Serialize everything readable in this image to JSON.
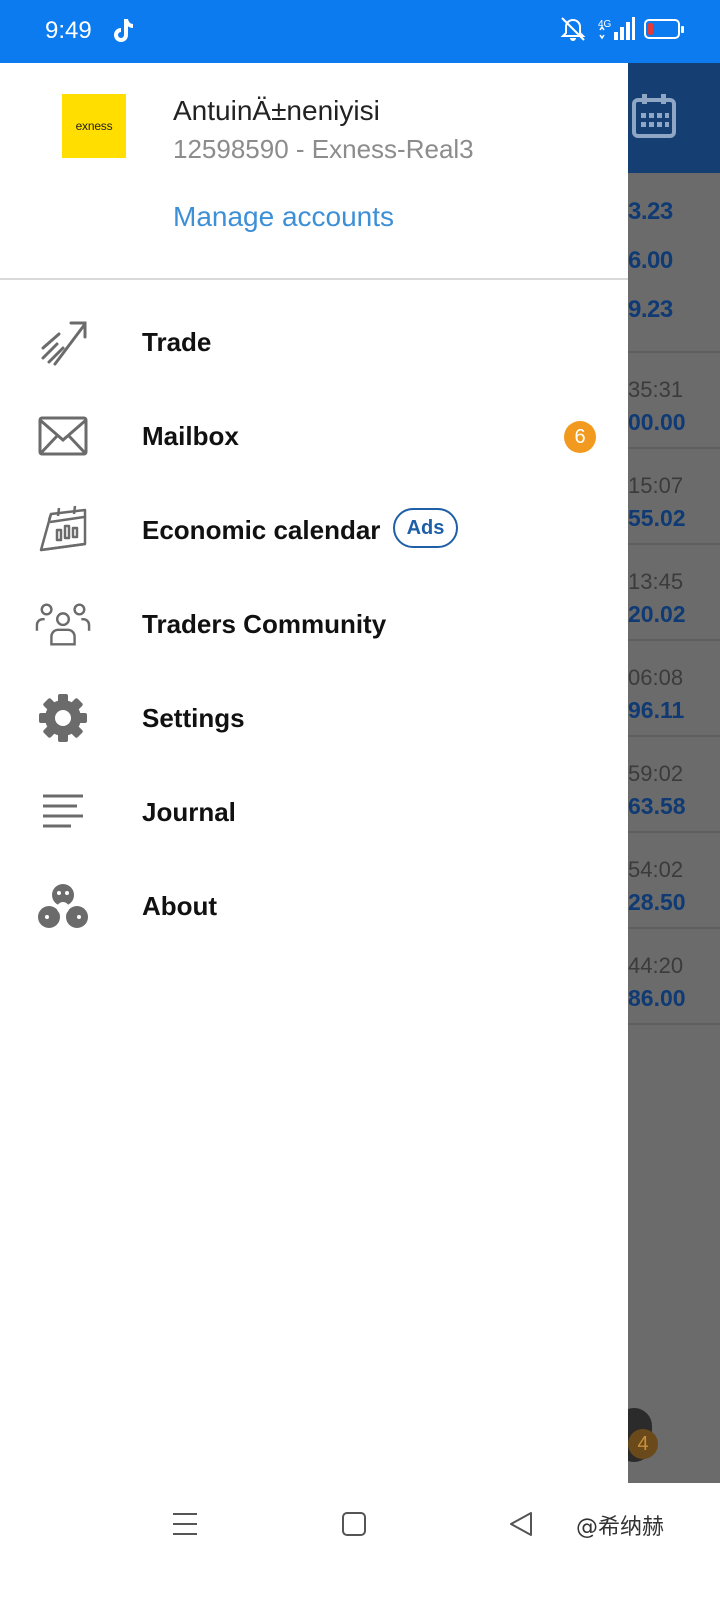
{
  "status_bar": {
    "time": "9:49",
    "icons": [
      "tiktok-icon",
      "mute-icon",
      "signal-4g-icon",
      "battery-icon"
    ],
    "network_label": "4G"
  },
  "account": {
    "logo_text": "exness",
    "name": "AntuinÄ±neniyisi",
    "id_line": "12598590 - Exness-Real3",
    "manage_label": "Manage accounts"
  },
  "menu": [
    {
      "label": "Trade",
      "icon": "trade-chart-icon"
    },
    {
      "label": "Mailbox",
      "icon": "envelope-icon",
      "badge": "6"
    },
    {
      "label": "Economic calendar",
      "icon": "calendar-icon",
      "tag": "Ads"
    },
    {
      "label": "Traders Community",
      "icon": "community-icon"
    },
    {
      "label": "Settings",
      "icon": "gear-icon"
    },
    {
      "label": "Journal",
      "icon": "journal-lines-icon"
    },
    {
      "label": "About",
      "icon": "metaquotes-logo-icon"
    }
  ],
  "background_app": {
    "quotes": [
      "3.23",
      "6.00",
      "9.23"
    ],
    "rows": [
      {
        "time": "35:31",
        "value": "00.00"
      },
      {
        "time": "15:07",
        "value": "55.02"
      },
      {
        "time": "13:45",
        "value": "20.02"
      },
      {
        "time": "06:08",
        "value": "96.11"
      },
      {
        "time": "59:02",
        "value": "63.58"
      },
      {
        "time": "54:02",
        "value": "28.50"
      },
      {
        "time": "44:20",
        "value": "86.00"
      }
    ],
    "fab_badge": "4"
  },
  "nav_bar": {
    "buttons": [
      "menu-icon",
      "home-square-icon",
      "back-triangle-icon"
    ],
    "watermark": "@希纳赫"
  },
  "colors": {
    "status_bar": "#0d7bf0",
    "accent_link": "#3d8fd6",
    "badge_orange": "#f29a1f",
    "brand_yellow": "#ffde00"
  }
}
